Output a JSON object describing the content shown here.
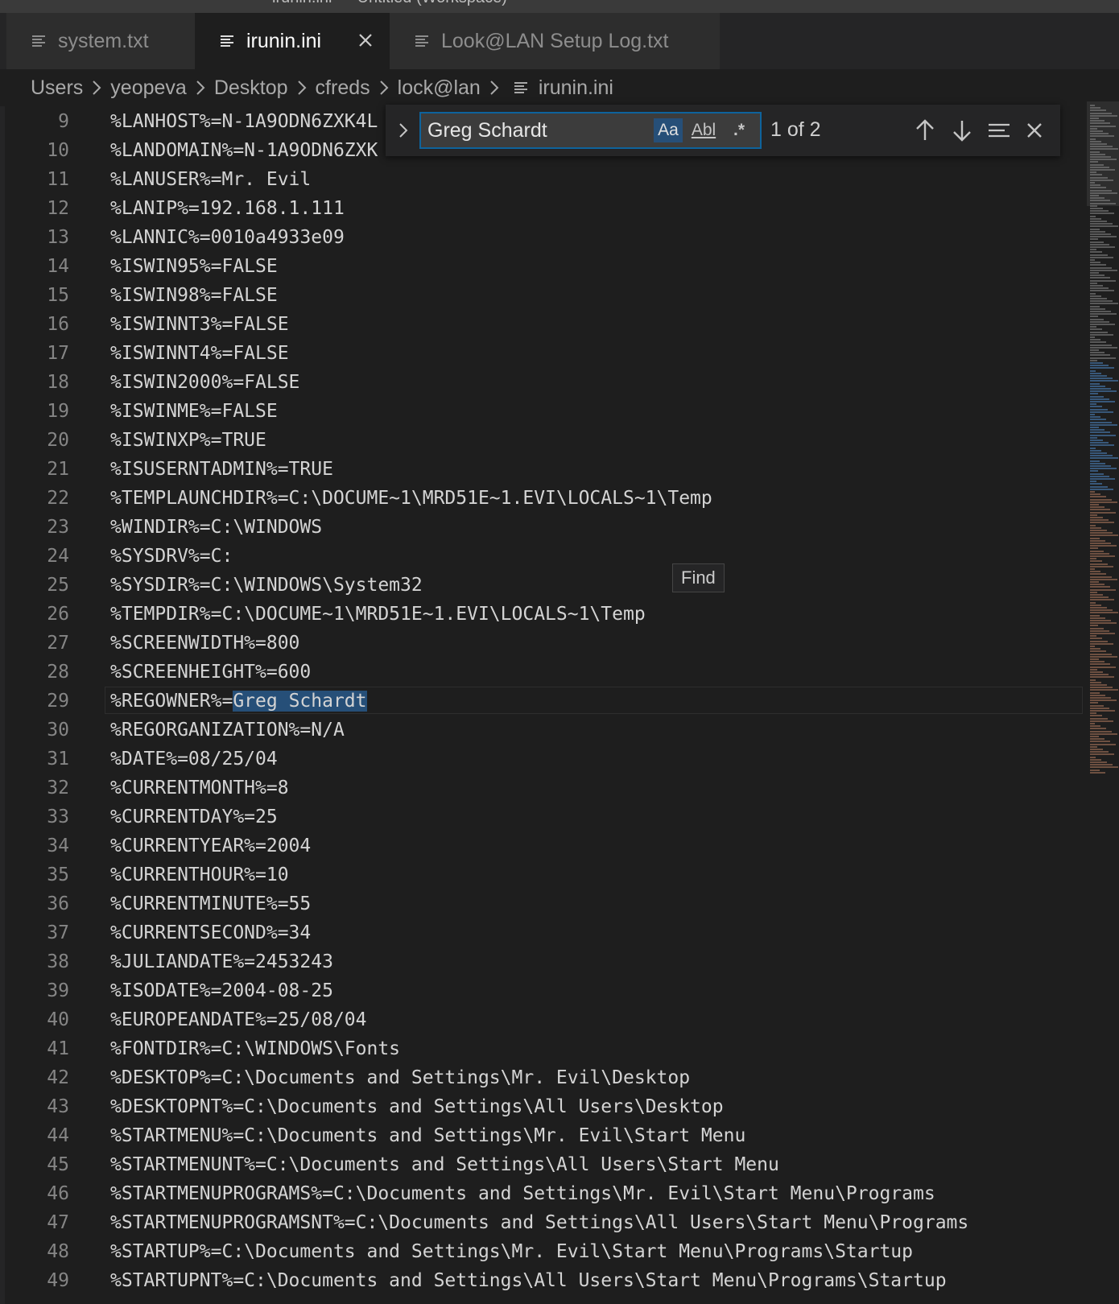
{
  "window": {
    "title": "irunin.ini — Untitled (Workspace)"
  },
  "tabs": [
    {
      "label": "system.txt"
    },
    {
      "label": "irunin.ini"
    },
    {
      "label": "Look@LAN Setup Log.txt"
    }
  ],
  "breadcrumb": [
    "Users",
    "yeopeva",
    "Desktop",
    "cfreds",
    "lock@lan",
    "irunin.ini"
  ],
  "find": {
    "query": "Greg Schardt",
    "match_case_label": "Aa",
    "whole_word_label": "Abl",
    "regex_label": ".*",
    "count": "1 of 2",
    "tooltip": "Find"
  },
  "editor": {
    "lines": [
      {
        "n": "9",
        "text": "%LANHOST%=N-1A9ODN6ZXK4L"
      },
      {
        "n": "10",
        "text": "%LANDOMAIN%=N-1A9ODN6ZXK"
      },
      {
        "n": "11",
        "text": "%LANUSER%=Mr. Evil"
      },
      {
        "n": "12",
        "text": "%LANIP%=192.168.1.111"
      },
      {
        "n": "13",
        "text": "%LANNIC%=0010a4933e09"
      },
      {
        "n": "14",
        "text": "%ISWIN95%=FALSE"
      },
      {
        "n": "15",
        "text": "%ISWIN98%=FALSE"
      },
      {
        "n": "16",
        "text": "%ISWINNT3%=FALSE"
      },
      {
        "n": "17",
        "text": "%ISWINNT4%=FALSE"
      },
      {
        "n": "18",
        "text": "%ISWIN2000%=FALSE"
      },
      {
        "n": "19",
        "text": "%ISWINME%=FALSE"
      },
      {
        "n": "20",
        "text": "%ISWINXP%=TRUE"
      },
      {
        "n": "21",
        "text": "%ISUSERNTADMIN%=TRUE"
      },
      {
        "n": "22",
        "text": "%TEMPLAUNCHDIR%=C:\\DOCUME~1\\MRD51E~1.EVI\\LOCALS~1\\Temp"
      },
      {
        "n": "23",
        "text": "%WINDIR%=C:\\WINDOWS"
      },
      {
        "n": "24",
        "text": "%SYSDRV%=C:"
      },
      {
        "n": "25",
        "text": "%SYSDIR%=C:\\WINDOWS\\System32"
      },
      {
        "n": "26",
        "text": "%TEMPDIR%=C:\\DOCUME~1\\MRD51E~1.EVI\\LOCALS~1\\Temp"
      },
      {
        "n": "27",
        "text": "%SCREENWIDTH%=800"
      },
      {
        "n": "28",
        "text": "%SCREENHEIGHT%=600"
      },
      {
        "n": "29",
        "text": "%REGOWNER%=",
        "match": "Greg Schardt",
        "current": true
      },
      {
        "n": "30",
        "text": "%REGORGANIZATION%=N/A"
      },
      {
        "n": "31",
        "text": "%DATE%=08/25/04"
      },
      {
        "n": "32",
        "text": "%CURRENTMONTH%=8"
      },
      {
        "n": "33",
        "text": "%CURRENTDAY%=25"
      },
      {
        "n": "34",
        "text": "%CURRENTYEAR%=2004"
      },
      {
        "n": "35",
        "text": "%CURRENTHOUR%=10"
      },
      {
        "n": "36",
        "text": "%CURRENTMINUTE%=55"
      },
      {
        "n": "37",
        "text": "%CURRENTSECOND%=34"
      },
      {
        "n": "38",
        "text": "%JULIANDATE%=2453243"
      },
      {
        "n": "39",
        "text": "%ISODATE%=2004-08-25"
      },
      {
        "n": "40",
        "text": "%EUROPEANDATE%=25/08/04"
      },
      {
        "n": "41",
        "text": "%FONTDIR%=C:\\WINDOWS\\Fonts"
      },
      {
        "n": "42",
        "text": "%DESKTOP%=C:\\Documents and Settings\\Mr. Evil\\Desktop"
      },
      {
        "n": "43",
        "text": "%DESKTOPNT%=C:\\Documents and Settings\\All Users\\Desktop"
      },
      {
        "n": "44",
        "text": "%STARTMENU%=C:\\Documents and Settings\\Mr. Evil\\Start Menu"
      },
      {
        "n": "45",
        "text": "%STARTMENUNT%=C:\\Documents and Settings\\All Users\\Start Menu"
      },
      {
        "n": "46",
        "text": "%STARTMENUPROGRAMS%=C:\\Documents and Settings\\Mr. Evil\\Start Menu\\Programs"
      },
      {
        "n": "47",
        "text": "%STARTMENUPROGRAMSNT%=C:\\Documents and Settings\\All Users\\Start Menu\\Programs"
      },
      {
        "n": "48",
        "text": "%STARTUP%=C:\\Documents and Settings\\Mr. Evil\\Start Menu\\Programs\\Startup"
      },
      {
        "n": "49",
        "text": "%STARTUPNT%=C:\\Documents and Settings\\All Users\\Start Menu\\Programs\\Startup"
      }
    ]
  },
  "colors": {
    "editor_bg": "#1e1e1e",
    "tab_active_bg": "#1e1e1e",
    "tab_inactive_bg": "#2d2d2d",
    "find_border": "#0e639c",
    "match_highlight": "#264f78"
  },
  "icons": {
    "file": "file-lines-icon",
    "close": "close-icon",
    "chevron": "chevron-right-icon",
    "prev": "arrow-up-icon",
    "next": "arrow-down-icon",
    "selection": "find-in-selection-icon"
  }
}
